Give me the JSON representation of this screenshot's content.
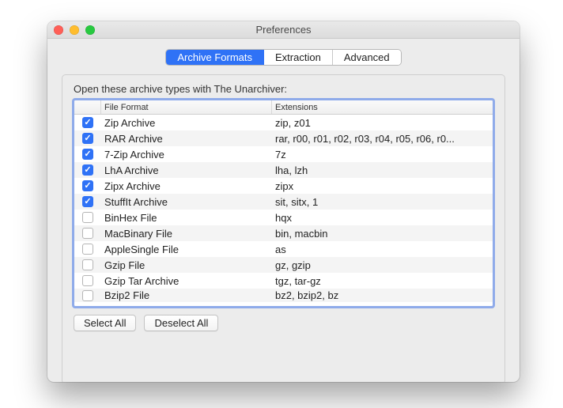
{
  "window": {
    "title": "Preferences"
  },
  "tabs": [
    {
      "label": "Archive Formats",
      "active": true
    },
    {
      "label": "Extraction",
      "active": false
    },
    {
      "label": "Advanced",
      "active": false
    }
  ],
  "group": {
    "label": "Open these archive types with The Unarchiver:"
  },
  "table": {
    "headers": {
      "format": "File Format",
      "extensions": "Extensions"
    },
    "rows": [
      {
        "checked": true,
        "format": "Zip Archive",
        "ext": "zip, z01"
      },
      {
        "checked": true,
        "format": "RAR Archive",
        "ext": "rar, r00, r01, r02, r03, r04, r05, r06, r0..."
      },
      {
        "checked": true,
        "format": "7-Zip Archive",
        "ext": "7z"
      },
      {
        "checked": true,
        "format": "LhA Archive",
        "ext": "lha, lzh"
      },
      {
        "checked": true,
        "format": "Zipx Archive",
        "ext": "zipx"
      },
      {
        "checked": true,
        "format": "StuffIt Archive",
        "ext": "sit, sitx, 1"
      },
      {
        "checked": false,
        "format": "BinHex File",
        "ext": "hqx"
      },
      {
        "checked": false,
        "format": "MacBinary File",
        "ext": "bin, macbin"
      },
      {
        "checked": false,
        "format": "AppleSingle File",
        "ext": "as"
      },
      {
        "checked": false,
        "format": "Gzip File",
        "ext": "gz, gzip"
      },
      {
        "checked": false,
        "format": "Gzip Tar Archive",
        "ext": "tgz, tar-gz"
      },
      {
        "checked": false,
        "format": "Bzip2 File",
        "ext": "bz2, bzip2, bz"
      }
    ]
  },
  "buttons": {
    "selectAll": "Select All",
    "deselectAll": "Deselect All"
  }
}
